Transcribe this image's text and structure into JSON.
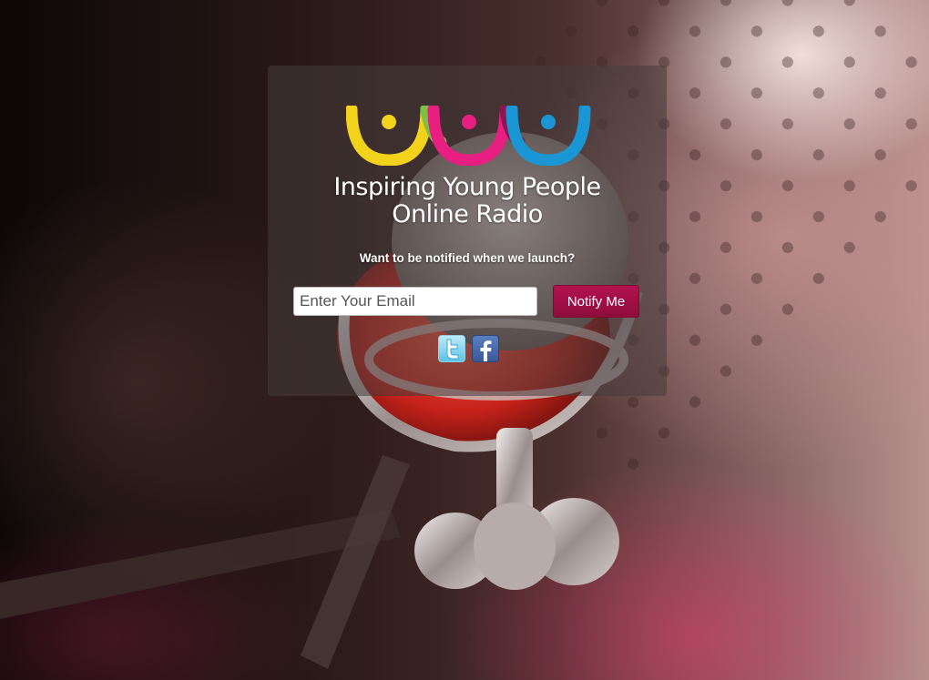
{
  "brand": {
    "title_line1": "Inspiring Young People",
    "title_line2": "Online Radio",
    "logo_colors": [
      "#f2d21a",
      "#7cc142",
      "#e61f80",
      "#8a1550",
      "#1a96d4"
    ]
  },
  "signup": {
    "question": "Want to be notified when we launch?",
    "email_placeholder": "Enter Your Email",
    "notify_label": "Notify Me"
  },
  "social": {
    "icons": [
      "twitter-icon",
      "facebook-icon"
    ]
  },
  "colors": {
    "button": "#a3104a",
    "card_overlay": "rgba(70,60,60,0.55)"
  }
}
